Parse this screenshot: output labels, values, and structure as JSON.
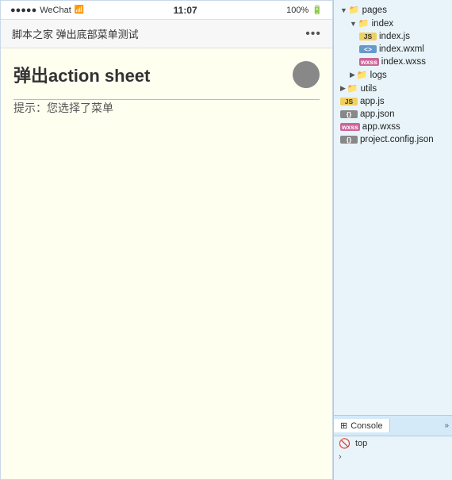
{
  "phone": {
    "statusBar": {
      "signal": "●●●●●",
      "carrier": "WeChat",
      "wifi": "▲",
      "time": "11:07",
      "battery": "100%",
      "batteryIcon": "▓"
    },
    "navBar": {
      "title": "脚本之家 弹出底部菜单测试",
      "dots": "•••"
    },
    "content": {
      "actionTitle": "弹出action sheet",
      "hintText": "提示：您选择了菜单"
    }
  },
  "fileTree": {
    "items": [
      {
        "indent": 1,
        "type": "folder",
        "open": true,
        "label": "pages"
      },
      {
        "indent": 2,
        "type": "folder",
        "open": true,
        "label": "index"
      },
      {
        "indent": 3,
        "type": "js",
        "label": "index.js"
      },
      {
        "indent": 3,
        "type": "xml",
        "label": "index.wxml"
      },
      {
        "indent": 3,
        "type": "wxss",
        "label": "index.wxss"
      },
      {
        "indent": 2,
        "type": "folder",
        "open": false,
        "label": "logs"
      },
      {
        "indent": 1,
        "type": "folder",
        "open": false,
        "label": "utils"
      },
      {
        "indent": 1,
        "type": "js",
        "label": "app.js"
      },
      {
        "indent": 1,
        "type": "json",
        "label": "app.json"
      },
      {
        "indent": 1,
        "type": "wxss",
        "label": "app.wxss"
      },
      {
        "indent": 1,
        "type": "json",
        "label": "project.config.json"
      }
    ]
  },
  "bottomPanel": {
    "tabs": [
      {
        "id": "console",
        "label": "Console",
        "active": true
      }
    ],
    "consoleContent": {
      "icon": "🚫",
      "text": "top"
    },
    "inputPlaceholder": ">"
  }
}
